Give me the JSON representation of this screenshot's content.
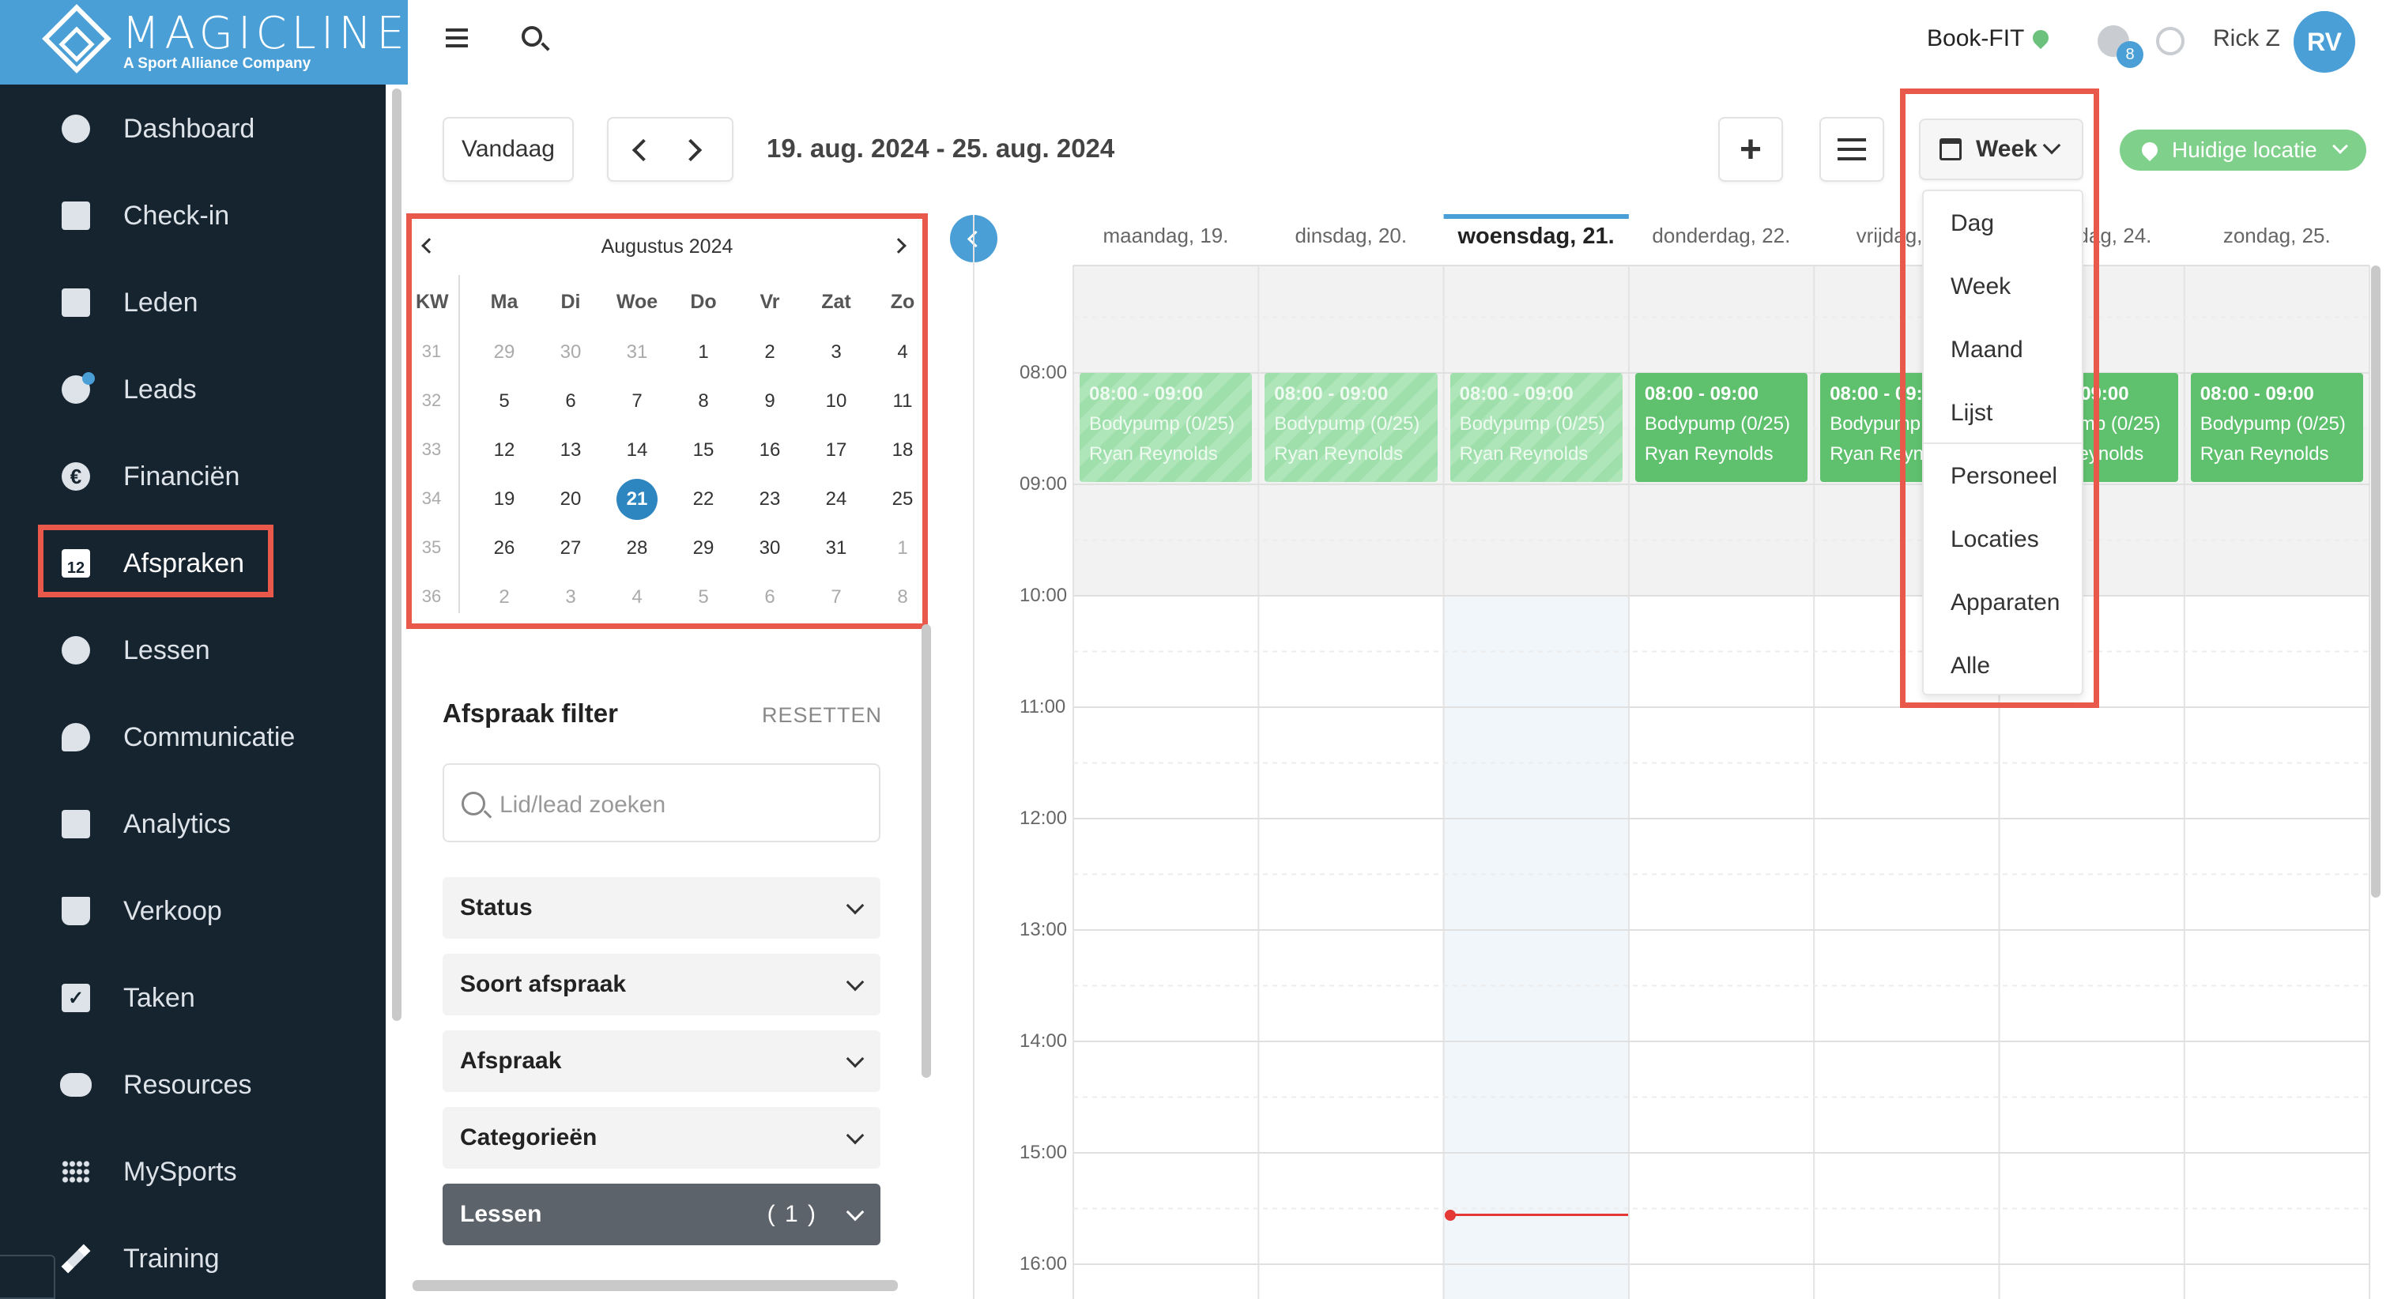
{
  "brand": {
    "name": "MAGICLINE",
    "tagline": "A Sport Alliance Company"
  },
  "sidebar": {
    "items": [
      {
        "label": "Dashboard",
        "icon": "dashboard-icon"
      },
      {
        "label": "Check-in",
        "icon": "check-in-icon"
      },
      {
        "label": "Leden",
        "icon": "members-icon"
      },
      {
        "label": "Leads",
        "icon": "leads-icon"
      },
      {
        "label": "Financiën",
        "icon": "euro-icon"
      },
      {
        "label": "Afspraken",
        "icon": "calendar-icon"
      },
      {
        "label": "Lessen",
        "icon": "timer-icon"
      },
      {
        "label": "Communicatie",
        "icon": "chat-icon"
      },
      {
        "label": "Analytics",
        "icon": "chart-icon"
      },
      {
        "label": "Verkoop",
        "icon": "cart-icon"
      },
      {
        "label": "Taken",
        "icon": "task-check-icon"
      },
      {
        "label": "Resources",
        "icon": "people-icon"
      },
      {
        "label": "MySports",
        "icon": "dots-grid-icon"
      },
      {
        "label": "Training",
        "icon": "dumbbell-icon"
      }
    ],
    "active": "Afspraken",
    "calendar_icon_day": "12"
  },
  "topbar": {
    "studio": "Book-FIT",
    "notifications": "8",
    "user": "Rick Z",
    "avatar_initials": "RV"
  },
  "toolbar": {
    "today": "Vandaag",
    "range": "19. aug. 2024 - 25. aug. 2024",
    "view": "Week",
    "location": "Huidige locatie"
  },
  "mini_calendar": {
    "month": "Augustus 2024",
    "week_label": "KW",
    "headers": [
      "Ma",
      "Di",
      "Woe",
      "Do",
      "Vr",
      "Zat",
      "Zo"
    ],
    "weeks": [
      {
        "kw": "31",
        "days": [
          "29",
          "30",
          "31",
          "1",
          "2",
          "3",
          "4"
        ]
      },
      {
        "kw": "32",
        "days": [
          "5",
          "6",
          "7",
          "8",
          "9",
          "10",
          "11"
        ]
      },
      {
        "kw": "33",
        "days": [
          "12",
          "13",
          "14",
          "15",
          "16",
          "17",
          "18"
        ]
      },
      {
        "kw": "34",
        "days": [
          "19",
          "20",
          "21",
          "22",
          "23",
          "24",
          "25"
        ]
      },
      {
        "kw": "35",
        "days": [
          "26",
          "27",
          "28",
          "29",
          "30",
          "31",
          "1"
        ]
      },
      {
        "kw": "36",
        "days": [
          "2",
          "3",
          "4",
          "5",
          "6",
          "7",
          "8"
        ]
      }
    ],
    "today": "21"
  },
  "filter": {
    "title": "Afspraak filter",
    "reset": "RESETTEN",
    "search_placeholder": "Lid/lead zoeken",
    "sections": [
      "Status",
      "Soort afspraak",
      "Afspraak",
      "Categorieën"
    ],
    "active_section": {
      "label": "Lessen",
      "count": "( 1 )"
    }
  },
  "week": {
    "days": [
      "maandag, 19.",
      "dinsdag, 20.",
      "woensdag, 21.",
      "donderdag, 22.",
      "vrijdag, 23.",
      "zaterdag, 24.",
      "zondag, 25."
    ],
    "hours": [
      "08:00",
      "09:00",
      "10:00",
      "11:00",
      "12:00",
      "13:00",
      "14:00",
      "15:00",
      "16:00"
    ]
  },
  "events": [
    {
      "day": "maandag, 19.",
      "time": "08:00 - 09:00",
      "title": "Bodypump (0/25)",
      "trainer": "Ryan Reynolds",
      "state": "past"
    },
    {
      "day": "dinsdag, 20.",
      "time": "08:00 - 09:00",
      "title": "Bodypump (0/25)",
      "trainer": "Ryan Reynolds",
      "state": "past"
    },
    {
      "day": "woensdag, 21.",
      "time": "08:00 - 09:00",
      "title": "Bodypump (0/25)",
      "trainer": "Ryan Reynolds",
      "state": "past"
    },
    {
      "day": "donderdag, 22.",
      "time": "08:00 - 09:00",
      "title": "Bodypump (0/25)",
      "trainer": "Ryan Reynolds",
      "state": "upcoming"
    },
    {
      "day": "vrijdag, 23.",
      "time": "08:00 - 09:00",
      "title": "Bodypump (0/25)",
      "trainer": "Ryan Reynolds",
      "state": "upcoming"
    },
    {
      "day": "zaterdag, 24.",
      "time": "08:00 - 09:00",
      "title": "Bodypump (0/25)",
      "trainer": "Ryan Reynolds",
      "state": "upcoming"
    },
    {
      "day": "zondag, 25.",
      "time": "08:00 - 09:00",
      "title": "Bodypump (0/25)",
      "trainer": "Ryan Reynolds",
      "state": "upcoming"
    }
  ],
  "view_menu": {
    "items": [
      "Dag",
      "Week",
      "Maand",
      "Lijst",
      "Personeel",
      "Locaties",
      "Apparaten",
      "Alle"
    ]
  },
  "colors": {
    "brand": "#4a9fd7",
    "sidebar": "#16242f",
    "event": "#5fc16e",
    "event_past": "#a8e3b4",
    "highlight": "#e8584b",
    "now_line": "#e53935"
  }
}
